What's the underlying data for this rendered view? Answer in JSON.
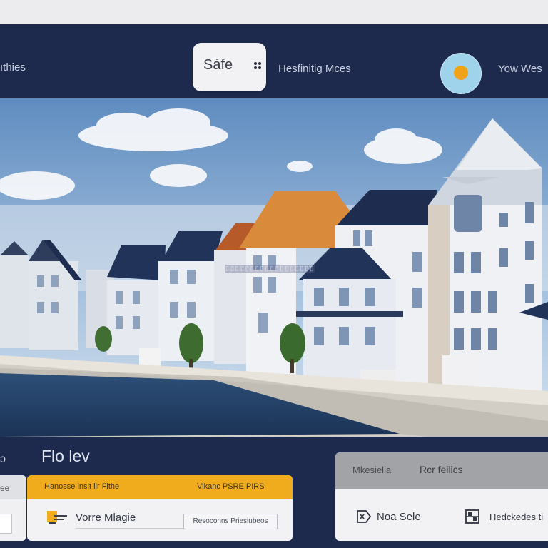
{
  "header": {
    "nav_left": "ıthies",
    "safe_button": "Sȧfe",
    "nav_middle": "Hesfinitig Mces",
    "nav_user": "Yow Wes"
  },
  "hero": {
    "caption": "▯▯▯▯▯▯▯▯▯▯▯▯▯▯▯▯▯▯"
  },
  "bottom": {
    "small_label": "ɔ",
    "title": "Flo lev",
    "left_card": {
      "head": "ee"
    },
    "main_card": {
      "head_left": "Hanosse lnsit lir Fithe",
      "head_right": "Vikanc PSRE PIRS",
      "item_label": "Vorre Mlagie",
      "input_value": "Resoconns Priesiubeos"
    },
    "right_card": {
      "head_left": "Mkesielia",
      "head_right": "Rcr feilics",
      "item1_label": "Noa Sele",
      "item2_label": "Hedckedes ti"
    }
  },
  "colors": {
    "header_bg": "#1d2a4d",
    "accent": "#f1ac1d",
    "avatar_bg": "#9fd3ec",
    "avatar_dot": "#f1a21b"
  },
  "icons": {
    "safe_button": "grid-icon",
    "avatar": "user-avatar",
    "item": "note-icon",
    "right_item1": "tag-icon",
    "right_item2": "building-icon"
  }
}
